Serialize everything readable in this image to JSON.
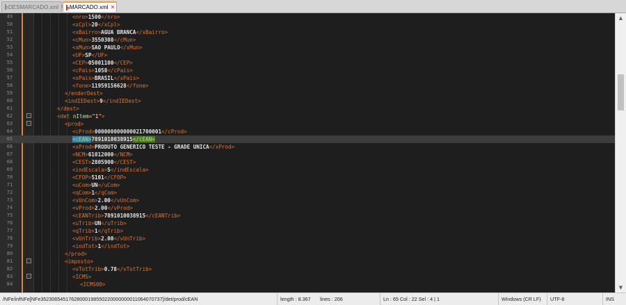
{
  "tabs": [
    {
      "label": "DESMARCADO.xml",
      "active": false
    },
    {
      "label": "MARCADO.xml",
      "active": true
    }
  ],
  "editor": {
    "current_line": 65,
    "lines": [
      {
        "n": "49",
        "indent": 5,
        "tag": "nro",
        "text": "1500"
      },
      {
        "n": "50",
        "indent": 5,
        "tag": "xCpl",
        "text": "20"
      },
      {
        "n": "51",
        "indent": 5,
        "tag": "xBairro",
        "text": "AGUA BRANCA"
      },
      {
        "n": "52",
        "indent": 5,
        "tag": "cMun",
        "text": "3550308"
      },
      {
        "n": "53",
        "indent": 5,
        "tag": "xMun",
        "text": "SAO PAULO"
      },
      {
        "n": "54",
        "indent": 5,
        "tag": "UF",
        "text": "SP"
      },
      {
        "n": "55",
        "indent": 5,
        "tag": "CEP",
        "text": "05001100"
      },
      {
        "n": "56",
        "indent": 5,
        "tag": "cPais",
        "text": "1058"
      },
      {
        "n": "57",
        "indent": 5,
        "tag": "xPais",
        "text": "BRASIL"
      },
      {
        "n": "58",
        "indent": 5,
        "tag": "fone",
        "text": "11959156628"
      },
      {
        "n": "59",
        "indent": 4,
        "raw": "</enderDest>"
      },
      {
        "n": "60",
        "indent": 4,
        "tag": "indIEDest",
        "text": "9"
      },
      {
        "n": "61",
        "indent": 3,
        "raw": "</dest>"
      },
      {
        "n": "62",
        "indent": 3,
        "open": "det",
        "attr": "nItem",
        "attrval": "\"1\"",
        "fold": "-"
      },
      {
        "n": "63",
        "indent": 4,
        "raw": "<prod>",
        "fold": "-"
      },
      {
        "n": "64",
        "indent": 5,
        "tag": "cProd",
        "text": "000000000000021700001"
      },
      {
        "n": "65",
        "indent": 5,
        "tag": "cEAN",
        "text": "7891010038915",
        "highlight": true
      },
      {
        "n": "66",
        "indent": 5,
        "tag": "xProd",
        "text": "PRODUTO GENERICO TESTE - GRADE UNICA"
      },
      {
        "n": "67",
        "indent": 5,
        "tag": "NCM",
        "text": "61012000"
      },
      {
        "n": "68",
        "indent": 5,
        "tag": "CEST",
        "text": "2805900"
      },
      {
        "n": "69",
        "indent": 5,
        "tag": "indEscala",
        "text": "S"
      },
      {
        "n": "70",
        "indent": 5,
        "tag": "CFOP",
        "text": "5101"
      },
      {
        "n": "71",
        "indent": 5,
        "tag": "uCom",
        "text": "UN"
      },
      {
        "n": "72",
        "indent": 5,
        "tag": "qCom",
        "text": "1"
      },
      {
        "n": "73",
        "indent": 5,
        "tag": "vUnCom",
        "text": "2.00"
      },
      {
        "n": "74",
        "indent": 5,
        "tag": "vProd",
        "text": "2.00"
      },
      {
        "n": "75",
        "indent": 5,
        "tag": "cEANTrib",
        "text": "7891010038915"
      },
      {
        "n": "76",
        "indent": 5,
        "tag": "uTrib",
        "text": "UN"
      },
      {
        "n": "77",
        "indent": 5,
        "tag": "qTrib",
        "text": "1"
      },
      {
        "n": "78",
        "indent": 5,
        "tag": "vUnTrib",
        "text": "2.00"
      },
      {
        "n": "79",
        "indent": 5,
        "tag": "indTot",
        "text": "1"
      },
      {
        "n": "80",
        "indent": 4,
        "raw": "</prod>"
      },
      {
        "n": "81",
        "indent": 4,
        "raw": "<imposto>",
        "fold": "-"
      },
      {
        "n": "82",
        "indent": 5,
        "tag": "vTotTrib",
        "text": "0.78"
      },
      {
        "n": "83",
        "indent": 5,
        "raw": "<ICMS>",
        "fold": "-"
      },
      {
        "n": "84",
        "indent": 6,
        "raw": "<ICMS00>"
      }
    ]
  },
  "status": {
    "path": "/NFe/infNFe[NFe35230654517628000198550220000000011064070737]/det/prod/cEAN",
    "length": "length : 8.367",
    "lines": "lines : 206",
    "position": "Ln : 65   Col : 22   Sel : 4 | 1",
    "eol": "Windows (CR LF)",
    "encoding": "UTF-8",
    "mode": "INS"
  },
  "colors": {
    "tag": "#e0762e",
    "text": "#e6e6e6",
    "current_line": "#3c3c3c",
    "match_highlight": "#3b7ea8",
    "change_marker": "#e08a2c"
  }
}
